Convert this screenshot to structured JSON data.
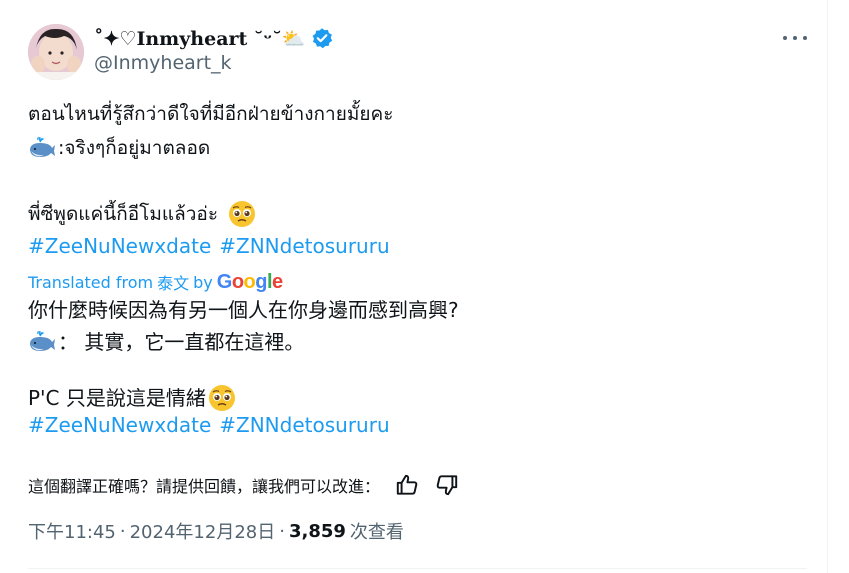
{
  "tweet": {
    "display_name": "˚✦♡Inmyheart ˘ᵕ˘⛅",
    "handle": "@Inmyheart_k",
    "more_icon": "more-horizontal-icon",
    "verified_color": "#1d9bf0",
    "original": {
      "line1": "ตอนไหนที่รู้สึกว่าดีใจที่มีอีกฝ่ายข้างกายมั้ยคะ",
      "line2": ":จริงๆก็อยู่มาตลอด",
      "line3": "พี่ซีพูดแค่นี้ก็อีโมแล้วอ่ะ",
      "hashtags": [
        "#ZeeNuNewxdate",
        "#ZNNdetosururu"
      ]
    },
    "translation": {
      "label_prefix": "Translated from",
      "source_language": "泰文",
      "label_by": "by",
      "google": [
        "G",
        "o",
        "o",
        "g",
        "l",
        "e"
      ],
      "line1": "你什麼時候因為有另一個人在你身邊而感到高興?",
      "line2": "： 其實，它一直都在這裡。",
      "line3": "P'C 只是說這是情緒",
      "hashtags": [
        "#ZeeNuNewxdate",
        "#ZNNdetosururu"
      ]
    },
    "feedback": {
      "prompt": "這個翻譯正確嗎？請提供回饋，讓我們可以改進：",
      "thumbs_up_icon": "thumbs-up-icon",
      "thumbs_down_icon": "thumbs-down-icon"
    },
    "meta": {
      "time": "下午11:45",
      "date": "2024年12月28日",
      "sep": "·",
      "views_count": "3,859",
      "views_label": "次查看"
    },
    "colors": {
      "link": "#1d9bf0",
      "secondary": "#536471",
      "text": "#0f1419"
    }
  }
}
